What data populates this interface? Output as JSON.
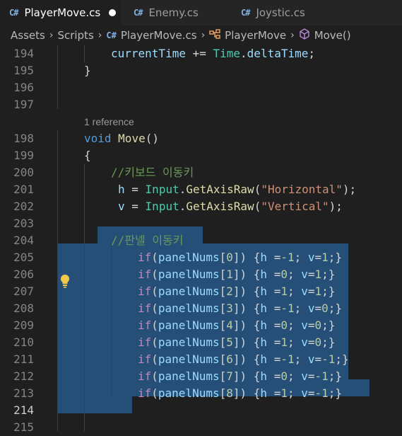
{
  "tabs": [
    {
      "label": "PlayerMove.cs",
      "active": true,
      "dirty": true
    },
    {
      "label": "Enemy.cs",
      "active": false
    },
    {
      "label": "Joystic.cs",
      "active": false
    }
  ],
  "breadcrumb": {
    "folder1": "Assets",
    "folder2": "Scripts",
    "file": "PlayerMove.cs",
    "class": "PlayerMove",
    "method": "Move()"
  },
  "codelens": "1 reference",
  "line_numbers": [
    "194",
    "195",
    "196",
    "197",
    "198",
    "199",
    "200",
    "201",
    "202",
    "203",
    "204",
    "205",
    "206",
    "207",
    "208",
    "209",
    "210",
    "211",
    "212",
    "213",
    "214",
    "215"
  ],
  "code": {
    "l194": {
      "a": "currentTime",
      "b": " += ",
      "c": "Time",
      "d": ".",
      "e": "deltaTime",
      "f": ";"
    },
    "l195": "}",
    "l198": {
      "kw": "void",
      "fn": "Move",
      "rest": "()"
    },
    "l199": "{",
    "l200": "//키보드 이동키",
    "l201": {
      "v": "h",
      "eq": " = ",
      "cls": "Input",
      "dot": ".",
      "fn": "GetAxisRaw",
      "p1": "(",
      "s": "\"Horizontal\"",
      "p2": ");"
    },
    "l202": {
      "v": "v",
      "eq": " = ",
      "cls": "Input",
      "dot": ".",
      "fn": "GetAxisRaw",
      "p1": "(",
      "s": "\"Vertical\"",
      "p2": ");"
    },
    "l204": "//판넬 이동키",
    "ifs": [
      {
        "idx": "0",
        "h": "-1",
        "v": "1"
      },
      {
        "idx": "1",
        "h": "0",
        "v": "1"
      },
      {
        "idx": "2",
        "h": "1",
        "v": "1"
      },
      {
        "idx": "3",
        "h": "-1",
        "v": "0"
      },
      {
        "idx": "4",
        "h": "0",
        "v": "0"
      },
      {
        "idx": "5",
        "h": "1",
        "v": "0"
      },
      {
        "idx": "6",
        "h": "-1",
        "v": "-1"
      },
      {
        "idx": "7",
        "h": "0",
        "v": "-1"
      },
      {
        "idx": "8",
        "h": "1",
        "v": "-1"
      }
    ],
    "if_kw": "if",
    "arr": "panelNums",
    "hvar": "h",
    "vvar": "v"
  },
  "colors": {
    "selection": "#264f78",
    "keyword": "#569cd6",
    "control": "#c586c0",
    "function": "#dcdcaa",
    "type": "#4ec9b0",
    "string": "#ce9178",
    "number": "#b5cea8",
    "comment": "#6a9955",
    "lightbulb": "#f2c94c"
  }
}
